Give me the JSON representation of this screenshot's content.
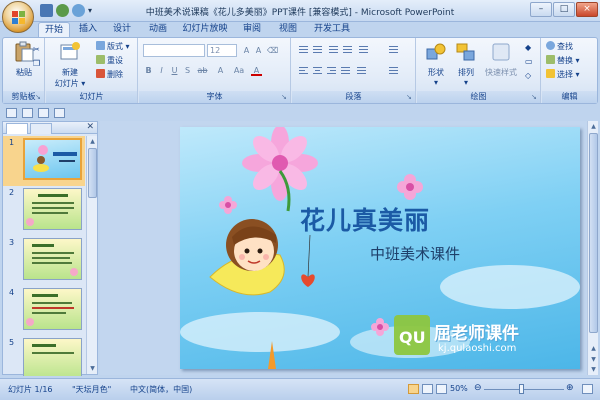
{
  "window": {
    "title": "中班美术说课稿《花儿多美丽》PPT课件 [兼容模式] - Microsoft PowerPoint",
    "controls": [
      "–",
      "□",
      "×"
    ]
  },
  "tabs": [
    {
      "label": "开始",
      "active": true
    },
    {
      "label": "插入"
    },
    {
      "label": "设计"
    },
    {
      "label": "动画"
    },
    {
      "label": "幻灯片放映"
    },
    {
      "label": "审阅"
    },
    {
      "label": "视图"
    },
    {
      "label": "开发工具"
    }
  ],
  "ribbon": {
    "clipboard": {
      "label": "剪贴板",
      "paste": "粘贴"
    },
    "slides": {
      "label": "幻灯片",
      "new_slide": "新建",
      "new_slide2": "幻灯片 ▾",
      "layout": "版式 ▾",
      "reset": "重设",
      "delete": "删除"
    },
    "font": {
      "label": "字体",
      "font_size": "12",
      "buttons": [
        "B",
        "I",
        "U",
        "S",
        "ab",
        "A",
        "Aa",
        "A"
      ]
    },
    "paragraph": {
      "label": "段落"
    },
    "drawing": {
      "label": "绘图",
      "shapes": "形状",
      "arrange": "排列",
      "quick_styles": "快速样式"
    },
    "editing": {
      "label": "编辑",
      "find": "查找",
      "replace": "替换 ▾",
      "select": "选择 ▾"
    }
  },
  "slide_pane": {
    "thumbnails": [
      {
        "number": "1",
        "selected": true
      },
      {
        "number": "2"
      },
      {
        "number": "3"
      },
      {
        "number": "4"
      },
      {
        "number": "5"
      }
    ]
  },
  "slide": {
    "title": "花儿真美丽",
    "subtitle": "中班美术课件",
    "watermark_brand": "屈老师课件",
    "watermark_url": "kj.qulaoshi.com",
    "watermark_logo": "QU"
  },
  "statusbar": {
    "slide_count": "幻灯片 1/16",
    "theme": "\"天坛月色\"",
    "language": "中文(简体，中国)",
    "zoom": "50%",
    "zoom_minus": "⊖",
    "zoom_plus": "⊕"
  },
  "colors": {
    "ribbon_blue": "#15428b",
    "title_blue": "#1b5aa5",
    "selected_orange": "#f8d48d"
  }
}
